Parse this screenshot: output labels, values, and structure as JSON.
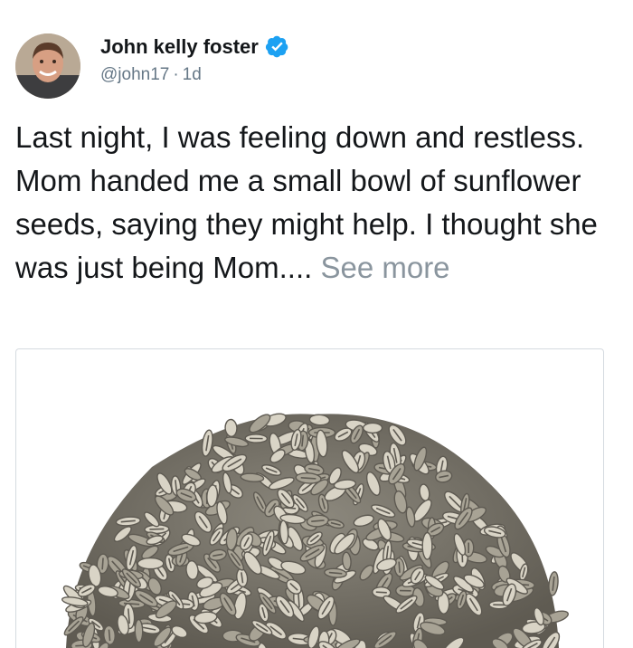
{
  "author": {
    "name": "John kelly foster",
    "handle": "@john17",
    "separator": "·",
    "time": "1d",
    "verified": true
  },
  "tweet": {
    "text": "Last night, I was feeling down and restless. Mom handed me a small bowl of sunflower seeds, saying they might help. I thought she was just being Mom....",
    "see_more": "See more"
  },
  "icons": {
    "avatar": "profile-photo",
    "verified": "verified-badge-icon"
  },
  "colors": {
    "verified_blue": "#1da1f2",
    "see_more": "#8a959e",
    "meta": "#657786",
    "seed_dark": "#5e5a52",
    "seed_light": "#d9d4c6"
  }
}
